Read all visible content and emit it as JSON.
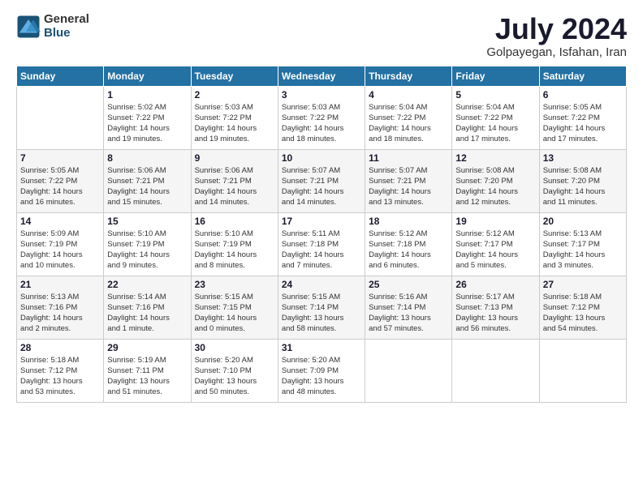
{
  "logo": {
    "general": "General",
    "blue": "Blue"
  },
  "title": "July 2024",
  "location": "Golpayegan, Isfahan, Iran",
  "days_of_week": [
    "Sunday",
    "Monday",
    "Tuesday",
    "Wednesday",
    "Thursday",
    "Friday",
    "Saturday"
  ],
  "weeks": [
    [
      {
        "day": "",
        "info": ""
      },
      {
        "day": "1",
        "info": "Sunrise: 5:02 AM\nSunset: 7:22 PM\nDaylight: 14 hours\nand 19 minutes."
      },
      {
        "day": "2",
        "info": "Sunrise: 5:03 AM\nSunset: 7:22 PM\nDaylight: 14 hours\nand 19 minutes."
      },
      {
        "day": "3",
        "info": "Sunrise: 5:03 AM\nSunset: 7:22 PM\nDaylight: 14 hours\nand 18 minutes."
      },
      {
        "day": "4",
        "info": "Sunrise: 5:04 AM\nSunset: 7:22 PM\nDaylight: 14 hours\nand 18 minutes."
      },
      {
        "day": "5",
        "info": "Sunrise: 5:04 AM\nSunset: 7:22 PM\nDaylight: 14 hours\nand 17 minutes."
      },
      {
        "day": "6",
        "info": "Sunrise: 5:05 AM\nSunset: 7:22 PM\nDaylight: 14 hours\nand 17 minutes."
      }
    ],
    [
      {
        "day": "7",
        "info": "Sunrise: 5:05 AM\nSunset: 7:22 PM\nDaylight: 14 hours\nand 16 minutes."
      },
      {
        "day": "8",
        "info": "Sunrise: 5:06 AM\nSunset: 7:21 PM\nDaylight: 14 hours\nand 15 minutes."
      },
      {
        "day": "9",
        "info": "Sunrise: 5:06 AM\nSunset: 7:21 PM\nDaylight: 14 hours\nand 14 minutes."
      },
      {
        "day": "10",
        "info": "Sunrise: 5:07 AM\nSunset: 7:21 PM\nDaylight: 14 hours\nand 14 minutes."
      },
      {
        "day": "11",
        "info": "Sunrise: 5:07 AM\nSunset: 7:21 PM\nDaylight: 14 hours\nand 13 minutes."
      },
      {
        "day": "12",
        "info": "Sunrise: 5:08 AM\nSunset: 7:20 PM\nDaylight: 14 hours\nand 12 minutes."
      },
      {
        "day": "13",
        "info": "Sunrise: 5:08 AM\nSunset: 7:20 PM\nDaylight: 14 hours\nand 11 minutes."
      }
    ],
    [
      {
        "day": "14",
        "info": "Sunrise: 5:09 AM\nSunset: 7:19 PM\nDaylight: 14 hours\nand 10 minutes."
      },
      {
        "day": "15",
        "info": "Sunrise: 5:10 AM\nSunset: 7:19 PM\nDaylight: 14 hours\nand 9 minutes."
      },
      {
        "day": "16",
        "info": "Sunrise: 5:10 AM\nSunset: 7:19 PM\nDaylight: 14 hours\nand 8 minutes."
      },
      {
        "day": "17",
        "info": "Sunrise: 5:11 AM\nSunset: 7:18 PM\nDaylight: 14 hours\nand 7 minutes."
      },
      {
        "day": "18",
        "info": "Sunrise: 5:12 AM\nSunset: 7:18 PM\nDaylight: 14 hours\nand 6 minutes."
      },
      {
        "day": "19",
        "info": "Sunrise: 5:12 AM\nSunset: 7:17 PM\nDaylight: 14 hours\nand 5 minutes."
      },
      {
        "day": "20",
        "info": "Sunrise: 5:13 AM\nSunset: 7:17 PM\nDaylight: 14 hours\nand 3 minutes."
      }
    ],
    [
      {
        "day": "21",
        "info": "Sunrise: 5:13 AM\nSunset: 7:16 PM\nDaylight: 14 hours\nand 2 minutes."
      },
      {
        "day": "22",
        "info": "Sunrise: 5:14 AM\nSunset: 7:16 PM\nDaylight: 14 hours\nand 1 minute."
      },
      {
        "day": "23",
        "info": "Sunrise: 5:15 AM\nSunset: 7:15 PM\nDaylight: 14 hours\nand 0 minutes."
      },
      {
        "day": "24",
        "info": "Sunrise: 5:15 AM\nSunset: 7:14 PM\nDaylight: 13 hours\nand 58 minutes."
      },
      {
        "day": "25",
        "info": "Sunrise: 5:16 AM\nSunset: 7:14 PM\nDaylight: 13 hours\nand 57 minutes."
      },
      {
        "day": "26",
        "info": "Sunrise: 5:17 AM\nSunset: 7:13 PM\nDaylight: 13 hours\nand 56 minutes."
      },
      {
        "day": "27",
        "info": "Sunrise: 5:18 AM\nSunset: 7:12 PM\nDaylight: 13 hours\nand 54 minutes."
      }
    ],
    [
      {
        "day": "28",
        "info": "Sunrise: 5:18 AM\nSunset: 7:12 PM\nDaylight: 13 hours\nand 53 minutes."
      },
      {
        "day": "29",
        "info": "Sunrise: 5:19 AM\nSunset: 7:11 PM\nDaylight: 13 hours\nand 51 minutes."
      },
      {
        "day": "30",
        "info": "Sunrise: 5:20 AM\nSunset: 7:10 PM\nDaylight: 13 hours\nand 50 minutes."
      },
      {
        "day": "31",
        "info": "Sunrise: 5:20 AM\nSunset: 7:09 PM\nDaylight: 13 hours\nand 48 minutes."
      },
      {
        "day": "",
        "info": ""
      },
      {
        "day": "",
        "info": ""
      },
      {
        "day": "",
        "info": ""
      }
    ]
  ]
}
